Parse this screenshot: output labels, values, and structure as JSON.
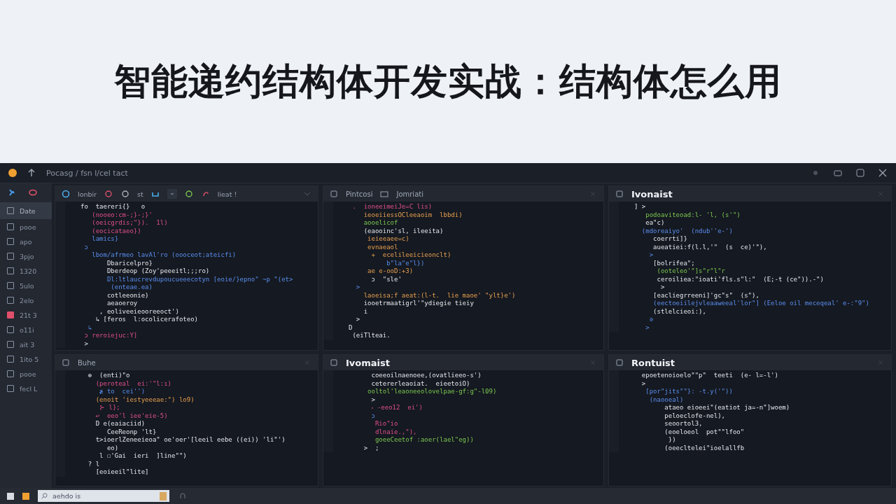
{
  "title": "智能递约结构体开发实战：结构体怎么用",
  "ide": {
    "breadcrumb": "Pocasg / fsn l/cel tact",
    "sidebar": {
      "items": [
        {
          "label": "Date",
          "selected": true,
          "kind": "file"
        },
        {
          "label": "pooe",
          "selected": false,
          "kind": "file"
        },
        {
          "label": "apo",
          "selected": false,
          "kind": "file"
        },
        {
          "label": "3pjo",
          "selected": false,
          "kind": "file"
        },
        {
          "label": "1320",
          "selected": false,
          "kind": "file"
        },
        {
          "label": "5ulo",
          "selected": false,
          "kind": "file"
        },
        {
          "label": "2elo",
          "selected": false,
          "kind": "file"
        },
        {
          "label": "21t 3",
          "selected": false,
          "kind": "marked"
        },
        {
          "label": "o11i",
          "selected": false,
          "kind": "file"
        },
        {
          "label": "ait 3",
          "selected": false,
          "kind": "file"
        },
        {
          "label": "1ito 5",
          "selected": false,
          "kind": "file"
        },
        {
          "label": "pooe",
          "selected": false,
          "kind": "file"
        },
        {
          "label": "fecl L",
          "selected": false,
          "kind": "file"
        }
      ]
    },
    "panels": [
      {
        "kind": "toolbar",
        "toolbar": [
          "lonbir",
          "st",
          "lieat !"
        ],
        "lines": [
          {
            "text": "fo  taereri{}   o",
            "kind": "plain"
          },
          {
            "text": "   (nooeo:cm-;}-;}'",
            "kind": "keyword"
          },
          {
            "text": "   (oeicgrdis;\"}).  1l)",
            "kind": "keyword"
          },
          {
            "text": "   (eocicataeo})",
            "kind": "keyword"
          },
          {
            "text": "   lamics}",
            "kind": "func"
          },
          {
            "text": " ɔ",
            "kind": "func"
          },
          {
            "text": "   lbom/afrmeo lavAl'ro (oooceot;ateicfi)",
            "kind": "func"
          },
          {
            "text": "       Dbaricelpro}",
            "kind": "plain"
          },
          {
            "text": "       Dberdeop (Zoy'peeeitl;;;ro)",
            "kind": "plain"
          },
          {
            "text": "       Dl:ltlaucrevdupoucueeecotyn [eoie/}epno\" ~p \"(et>",
            "kind": "func"
          },
          {
            "text": "        (enteae.ea)",
            "kind": "func"
          },
          {
            "text": "       cotleeonie)",
            "kind": "plain"
          },
          {
            "text": "       aeaoeroy",
            "kind": "plain"
          },
          {
            "text": "     , eoliveeieooreeoct')",
            "kind": "plain"
          },
          {
            "text": "    ↳ [feros  l:ocolicerafoteo)",
            "kind": "plain"
          },
          {
            "text": "  ↳",
            "kind": "func"
          },
          {
            "text": " ɔ reroiejuc:Y]",
            "kind": "keyword"
          },
          {
            "text": " >",
            "kind": "plain"
          }
        ]
      },
      {
        "kind": "titled",
        "title": "Pintcosi",
        "subtitle": "Jomriati",
        "emphasized": false,
        "lines": [
          {
            "text": " .  ioneeimeiJe=C lis)",
            "kind": "keyword"
          },
          {
            "text": "    ieoeiiessOCleeaoim  lbbdi)",
            "kind": "number"
          },
          {
            "text": "    aooelicof",
            "kind": "string"
          },
          {
            "text": "    (eaooinc'sl, ileeita)",
            "kind": "plain"
          },
          {
            "text": "     ieieeaee=c)",
            "kind": "number"
          },
          {
            "text": "     evnaeaol",
            "kind": "number"
          },
          {
            "text": "      +  ecelileeicieonclt)",
            "kind": "number"
          },
          {
            "text": "          b\"la\"e\"l})",
            "kind": "func"
          },
          {
            "text": "     ae e-ooD:+3)",
            "kind": "number"
          },
          {
            "text": "      ɔ  \"sle'",
            "kind": "plain"
          },
          {
            "text": "  >",
            "kind": "func"
          },
          {
            "text": "    laoeisa;f aeat:(l-t.  lie maoe' \"ylt}e')",
            "kind": "number"
          },
          {
            "text": "    iooetrmaatigrl'\"ydiegie tieiy",
            "kind": "plain"
          },
          {
            "text": "    i",
            "kind": "plain"
          },
          {
            "text": "  >",
            "kind": "plain"
          },
          {
            "text": "D",
            "kind": "plain"
          },
          {
            "text": " (eiTlteai.",
            "kind": "plain"
          }
        ]
      },
      {
        "kind": "titled",
        "title": "Ivonaist",
        "emphasized": true,
        "lines": [
          {
            "text": "] >",
            "kind": "plain"
          },
          {
            "text": "   podoaviteoad:l- 'l, (s'\")",
            "kind": "string"
          },
          {
            "text": "   ea\"c)",
            "kind": "plain"
          },
          {
            "text": "  (mdoreaiyo'  (ndub''e-')",
            "kind": "func"
          },
          {
            "text": "     coerrti]}",
            "kind": "plain"
          },
          {
            "text": "     aueatiei:f(l.l,'\"  (s  ce)'\"),",
            "kind": "plain"
          },
          {
            "text": "    >",
            "kind": "func"
          },
          {
            "text": "     [bolrifea\";",
            "kind": "plain"
          },
          {
            "text": "      (ooteleo'\"]s\"r\"l\"r",
            "kind": "string"
          },
          {
            "text": "      ceroiliea:\"ioati'fls.s\"l:\"  (E;-t (ce\")).-\")",
            "kind": "plain"
          },
          {
            "text": "       >",
            "kind": "plain"
          },
          {
            "text": "     [eacliegrreeni]'gc\"s\"  (s\"),",
            "kind": "plain"
          },
          {
            "text": "     (eectoeiilejvleaaweeal'lor\"] (Eeloe oil meceqeal' e-:\"9\")",
            "kind": "func"
          },
          {
            "text": "     (stlelcieoi:),",
            "kind": "plain"
          },
          {
            "text": "    ə",
            "kind": "func"
          },
          {
            "text": "   >",
            "kind": "func"
          }
        ]
      },
      {
        "kind": "titled",
        "title": "Buhe",
        "emphasized": false,
        "lines": [
          {
            "text": "  ⊕  (enti)\"o",
            "kind": "plain"
          },
          {
            "text": "    (peroteal  ei:'\"l:ı)",
            "kind": "keyword"
          },
          {
            "text": "     ≱ to  cei'')",
            "kind": "func"
          },
          {
            "text": "    (enoit 'iestyeeeae:\") lo9)",
            "kind": "number"
          },
          {
            "text": "     ⊱ l};",
            "kind": "keyword"
          },
          {
            "text": "    ↩  eeo'l iee'eie-5)",
            "kind": "keyword"
          },
          {
            "text": "    D e(eaiaciid)",
            "kind": "plain"
          },
          {
            "text": "       CeeReonp 'lt}",
            "kind": "plain"
          },
          {
            "text": "    t>ioerlZeneeieoa\" oe'oer'[leeil eebe ((ei)) 'li\"')",
            "kind": "plain"
          },
          {
            "text": "       eo)",
            "kind": "plain"
          },
          {
            "text": "     l ☐'Gai  ieri  ]line\"\")",
            "kind": "plain"
          },
          {
            "text": "  ? l",
            "kind": "plain"
          },
          {
            "text": "    [eoieeil\"lite]",
            "kind": "plain"
          }
        ]
      },
      {
        "kind": "titled",
        "title": "Ivomaist",
        "emphasized": true,
        "lines": [
          {
            "text": "      coeeoilnaenoee,(ovatlieeo-s')",
            "kind": "plain"
          },
          {
            "text": "      cetererleaoiat.  eieetoiO)",
            "kind": "plain"
          },
          {
            "text": "     ooltol'leaoneeolovelpae-gf:g\"-l09)",
            "kind": "string"
          },
          {
            "text": "      >",
            "kind": "plain"
          },
          {
            "text": "      ⸗ -eeo12  ei')",
            "kind": "keyword"
          },
          {
            "text": "      ɔ",
            "kind": "func"
          },
          {
            "text": "       Rio\"io",
            "kind": "keyword"
          },
          {
            "text": "       dlnaie.,\"),",
            "kind": "keyword"
          },
          {
            "text": "       goeeCeetof :aoer(lael\"eg))",
            "kind": "string"
          },
          {
            "text": "    >  ;",
            "kind": "plain"
          }
        ]
      },
      {
        "kind": "titled",
        "title": "Rontuist",
        "emphasized": true,
        "lines": [
          {
            "text": "  epoetenoioelo\"\"p\"  teeti  (e- l=-l')",
            "kind": "plain"
          },
          {
            "text": "  >",
            "kind": "plain"
          },
          {
            "text": "   [por\"jits\"\"}: -t.y('\"))",
            "kind": "func"
          },
          {
            "text": "    (naooeal)",
            "kind": "func"
          },
          {
            "text": "        ataeo eioeei\"(eatiot ja=-n\"]woem)",
            "kind": "plain"
          },
          {
            "text": "        peloeclofe-nel),",
            "kind": "plain"
          },
          {
            "text": "        seoortol3,",
            "kind": "plain"
          },
          {
            "text": "        (eoeloeol  pot\"\"lfoo\"",
            "kind": "plain"
          },
          {
            "text": "         })",
            "kind": "plain"
          },
          {
            "text": "        (oeecltelei\"ioelallfb",
            "kind": "plain"
          }
        ]
      }
    ],
    "taskbar": {
      "search": "aehdo is"
    }
  }
}
